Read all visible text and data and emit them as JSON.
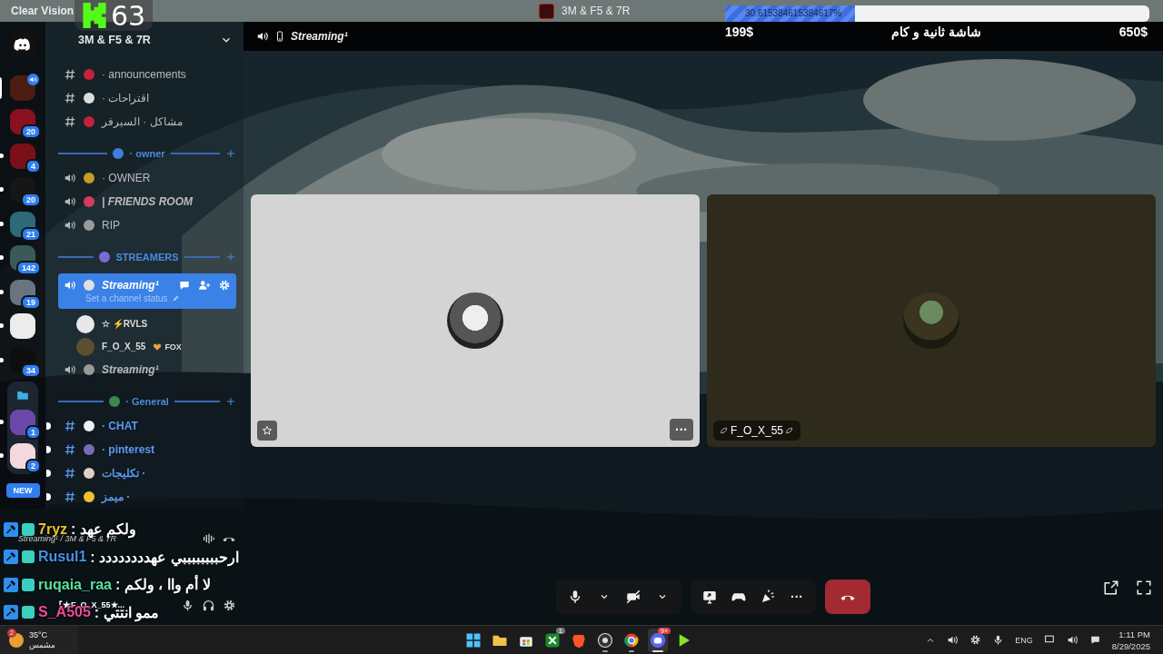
{
  "title_bar": {
    "app_name": "Clear Vision",
    "server_name": "3M & F5 & 7R"
  },
  "stream_overlay": {
    "viewers": "63",
    "goal": {
      "level": 0.306,
      "percent": "30.615384615384617%",
      "start": "199$",
      "label": "شاشة ثانية و كام",
      "end": "650$"
    }
  },
  "server_rail": {
    "items": [
      {
        "selected": true,
        "unread": false,
        "speaking": true,
        "color": "#4a1c12"
      },
      {
        "selected": false,
        "unread": false,
        "speaking": false,
        "badge": "20",
        "color": "#8a1020"
      },
      {
        "selected": false,
        "unread": true,
        "speaking": false,
        "badge": "4",
        "color": "#7a1018"
      },
      {
        "selected": false,
        "unread": true,
        "speaking": false,
        "badge": "20",
        "color": "#161616"
      },
      {
        "selected": false,
        "unread": true,
        "speaking": false,
        "badge": "21",
        "color": "#2c6a7a"
      },
      {
        "selected": false,
        "unread": true,
        "speaking": false,
        "badge": "142",
        "color": "#3a5a58"
      },
      {
        "selected": false,
        "unread": true,
        "speaking": false,
        "badge": "19",
        "color": "#6a7480"
      },
      {
        "selected": false,
        "unread": true,
        "speaking": false,
        "color": "#ececec"
      },
      {
        "selected": false,
        "unread": true,
        "speaking": false,
        "badge": "34",
        "color": "#0e0e0e"
      }
    ],
    "folder": [
      {
        "selected": false,
        "unread": true,
        "speaking": false,
        "badge": "1",
        "color": "#6a4aa8"
      },
      {
        "selected": false,
        "unread": true,
        "speaking": false,
        "badge": "2",
        "color": "#f4d8e0"
      }
    ],
    "new_label": "NEW"
  },
  "sidebar": {
    "server_name": "3M & F5 & 7R",
    "channels": [
      {
        "kind": "text",
        "name": "· announcements",
        "unread": false,
        "color": "#c8203a"
      },
      {
        "kind": "text",
        "name": "اقتراحات ·",
        "unread": false,
        "color": "#dcdcdc"
      },
      {
        "kind": "text",
        "name": "مشاكل · السيرفر",
        "unread": false,
        "color": "#c8203a"
      },
      {
        "kind": "category",
        "name": "· owner",
        "color": "#3d7fd9"
      },
      {
        "kind": "voice",
        "name": "· OWNER",
        "selected": false,
        "color": "#c89a2a"
      },
      {
        "kind": "voice",
        "name": "| FRIENDS ROOM",
        "selected": false,
        "color": "#d83a5a"
      },
      {
        "kind": "voice",
        "name": "RIP",
        "selected": false,
        "color": "#9a9a9a"
      },
      {
        "kind": "category",
        "name": "STREAMERS",
        "color": "#7a6ad8"
      },
      {
        "kind": "voice",
        "name": "Streaming¹",
        "selected": true,
        "status": "Set a channel status",
        "color": "#e0e0e0",
        "members": [
          {
            "name": "☆ ⚡RVLS",
            "color": "#e8e8e8"
          },
          {
            "name": "F_O_X_55",
            "tag": "FOX",
            "color": "#5a5030"
          }
        ]
      },
      {
        "kind": "voice",
        "name": "Streaming¹",
        "selected": false,
        "color": "#9a9a9a"
      },
      {
        "kind": "category",
        "name": "· General",
        "color": "#3a8a4a"
      },
      {
        "kind": "text",
        "name": "· CHAT",
        "unread": true,
        "color": "#f0f0f0"
      },
      {
        "kind": "text",
        "name": "· pinterest",
        "unread": true,
        "color": "#7a6ab8"
      },
      {
        "kind": "text",
        "name": "· تكليجات",
        "unread": true,
        "color": "#e0d0c0"
      },
      {
        "kind": "text",
        "name": "· ميمز",
        "unread": true,
        "color": "#f0c030"
      }
    ]
  },
  "user_panel": {
    "voice_status": "Streaming¹ / 3M & F5 & 7R",
    "user_name": "『★F_O_X_55★..."
  },
  "stage": {
    "channel": "Streaming¹",
    "tiles": [
      {
        "color": "#d4d4d4",
        "hovered": true
      },
      {
        "color": "#2e2b1c",
        "hovered": false,
        "name": "F_O_X_55"
      }
    ]
  },
  "controls": {
    "muted": false,
    "camera_on": false,
    "more": "···"
  },
  "chat": {
    "lines": [
      {
        "user": "7ryz",
        "color": "#e8c030",
        "message": ": ولكم عهد"
      },
      {
        "user": "Rusul1",
        "color": "#4a90e8",
        "message": ": ارحببببببببي عهدددددددد"
      },
      {
        "user": "ruqaia_raa",
        "color": "#5ae0a0",
        "message": ": لا أم واا ، ولكم"
      },
      {
        "user": "S_A505",
        "color": "#f04a9a",
        "message": ": ممو انتتي"
      }
    ]
  },
  "taskbar": {
    "weather": {
      "temp": "35°C",
      "condition": "مشمس",
      "badge": "2"
    },
    "apps": [
      {
        "kind": "start",
        "running": false
      },
      {
        "kind": "folder",
        "running": false
      },
      {
        "kind": "store",
        "running": false
      },
      {
        "kind": "xbox",
        "running": false,
        "badge": "1"
      },
      {
        "kind": "brave",
        "running": false
      },
      {
        "kind": "obs",
        "running": true
      },
      {
        "kind": "chrome",
        "running": true
      },
      {
        "kind": "discord",
        "running": true,
        "badge": "9+"
      },
      {
        "kind": "media",
        "running": false
      }
    ],
    "tray": {
      "lang": "ENG",
      "time": "1:11 PM",
      "date": "8/29/2025"
    }
  }
}
